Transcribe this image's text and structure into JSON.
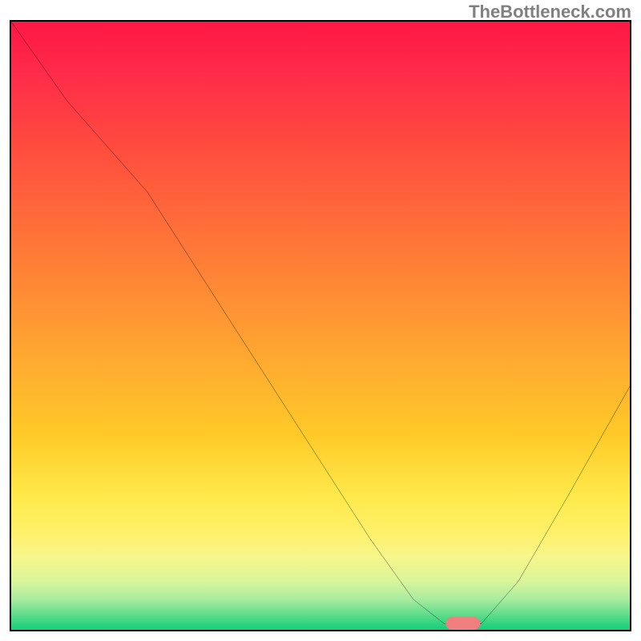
{
  "watermark": "TheBottleneck.com",
  "chart_data": {
    "type": "line",
    "title": "",
    "xlabel": "",
    "ylabel": "",
    "xlim": [
      0,
      100
    ],
    "ylim": [
      0,
      100
    ],
    "curve": [
      {
        "x": 0,
        "y": 100
      },
      {
        "x": 9,
        "y": 87
      },
      {
        "x": 22,
        "y": 72
      },
      {
        "x": 34,
        "y": 53
      },
      {
        "x": 46,
        "y": 34
      },
      {
        "x": 58,
        "y": 15
      },
      {
        "x": 65,
        "y": 5
      },
      {
        "x": 70,
        "y": 1
      },
      {
        "x": 76,
        "y": 1
      },
      {
        "x": 82,
        "y": 8
      },
      {
        "x": 90,
        "y": 22
      },
      {
        "x": 100,
        "y": 40
      }
    ],
    "marker": {
      "x": 73,
      "y": 1,
      "width_pct": 5.5
    }
  }
}
